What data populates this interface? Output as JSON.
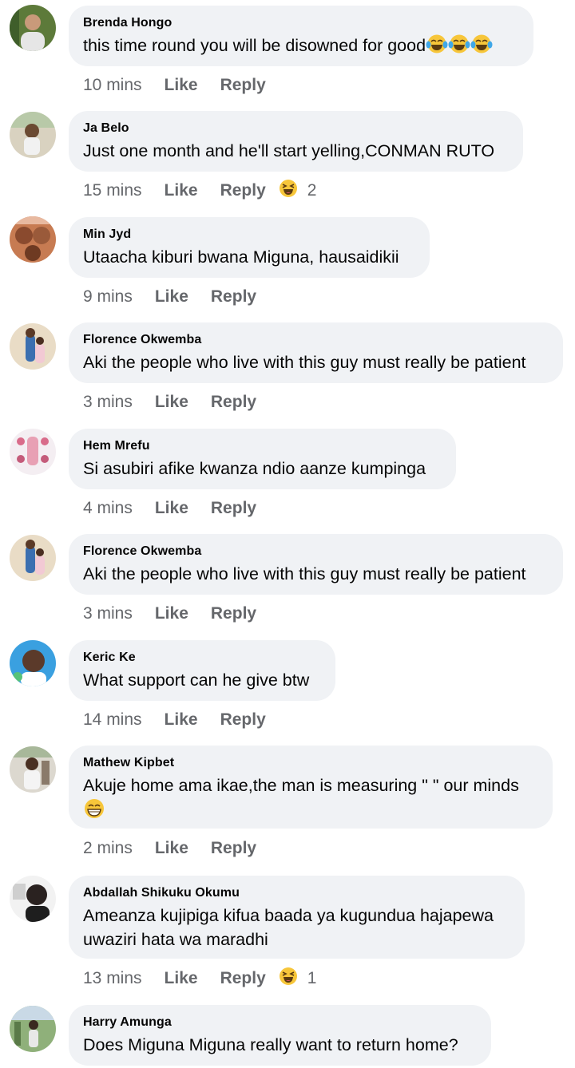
{
  "colors": {
    "bubble": "#f0f2f5",
    "secondary_text": "#65676b",
    "primary_text": "#050505",
    "emoji_face": "#f7c63a"
  },
  "comments": [
    {
      "author": "Brenda Hongo",
      "text": "this time round you will be disowned for good",
      "emoji": [
        "tears-of-joy-emoji",
        "tears-of-joy-emoji",
        "tears-of-joy-emoji"
      ],
      "time": "10 mins",
      "like": "Like",
      "reply": "Reply"
    },
    {
      "author": "Ja Belo",
      "text": "Just one month and he'll start yelling,CONMAN RUTO",
      "time": "15 mins",
      "like": "Like",
      "reply": "Reply",
      "reaction": {
        "icon": "haha-reaction-icon",
        "count": "2"
      }
    },
    {
      "author": "Min Jyd",
      "text": "Utaacha kiburi bwana Miguna, hausaidikii",
      "time": "9 mins",
      "like": "Like",
      "reply": "Reply"
    },
    {
      "author": "Florence Okwemba",
      "text": "Aki the people who live with this guy must really be patient",
      "time": "3 mins",
      "like": "Like",
      "reply": "Reply"
    },
    {
      "author": "Hem Mrefu",
      "text": "Si asubiri afike kwanza ndio aanze kumpinga",
      "time": "4 mins",
      "like": "Like",
      "reply": "Reply"
    },
    {
      "author": "Florence Okwemba",
      "text": "Aki the people who live with this guy must really be patient",
      "time": "3 mins",
      "like": "Like",
      "reply": "Reply"
    },
    {
      "author": "Keric Ke",
      "text": "What support can he give btw",
      "time": "14 mins",
      "like": "Like",
      "reply": "Reply"
    },
    {
      "author": "Mathew Kipbet",
      "text": "Akuje home ama ikae,the man is measuring \" \" our minds",
      "emoji": [
        "grinning-emoji"
      ],
      "time": "2 mins",
      "like": "Like",
      "reply": "Reply"
    },
    {
      "author": "Abdallah Shikuku Okumu",
      "text": "Ameanza kujipiga kifua baada ya kugundua hajapewa",
      "text2": "uwaziri hata wa maradhi",
      "time": "13 mins",
      "like": "Like",
      "reply": "Reply",
      "reaction": {
        "icon": "haha-reaction-icon",
        "count": "1"
      }
    },
    {
      "author": "Harry Amunga",
      "text": "Does Miguna Miguna really want to return home?"
    }
  ]
}
